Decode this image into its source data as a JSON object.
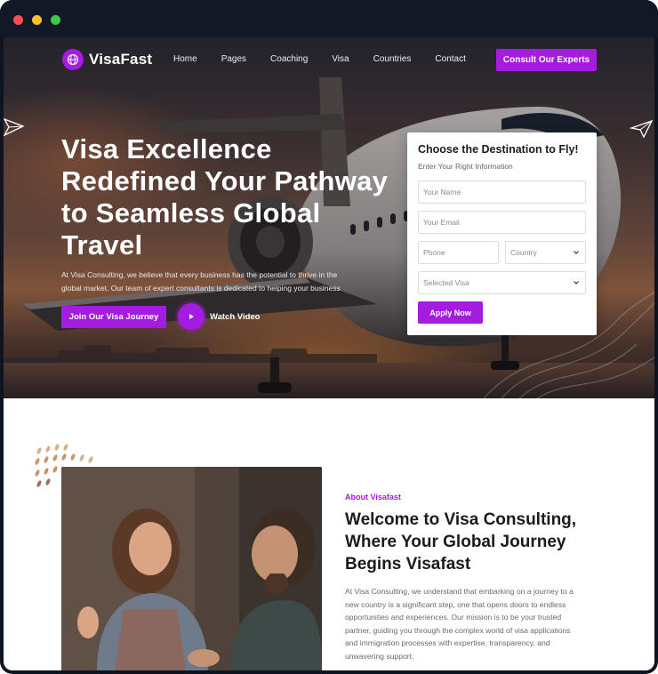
{
  "window": {
    "controls": [
      "close",
      "minimize",
      "maximize"
    ]
  },
  "brand": {
    "name": "VisaFast",
    "accent_color": "#a61be0",
    "logo_icon": "globe-icon"
  },
  "nav": {
    "links": [
      "Home",
      "Pages",
      "Coaching",
      "Visa",
      "Countries",
      "Contact"
    ],
    "cta_label": "Consult Our Experts"
  },
  "hero": {
    "title": "Visa Excellence Redefined Your Pathway to Seamless Global Travel",
    "description": "At Visa Consulting, we believe that every business has the potential to thrive in the global market. Our team of expert consultants is dedicated to helping your business",
    "primary_button": "Join Our Visa Journey",
    "video_label": "Watch Video"
  },
  "form": {
    "title": "Choose the Destination to Fly!",
    "subtitle": "Enter Your Right Information",
    "name_placeholder": "Your Name",
    "email_placeholder": "Your Email",
    "phone_placeholder": "Phone",
    "country_selected": "Country",
    "visa_selected": "Selected Visa",
    "submit_label": "Apply Now"
  },
  "about": {
    "tag": "About Visafast",
    "title": "Welcome to Visa Consulting, Where Your Global Journey Begins Visafast",
    "description": "At Visa Consulting, we understand that embarking on a journey to a new country is a significant step, one that opens doors to endless opportunities and experiences. Our mission is to be your trusted partner, guiding you through the complex world of visa applications and immigration processes with expertise, transparency, and unwavering support."
  }
}
